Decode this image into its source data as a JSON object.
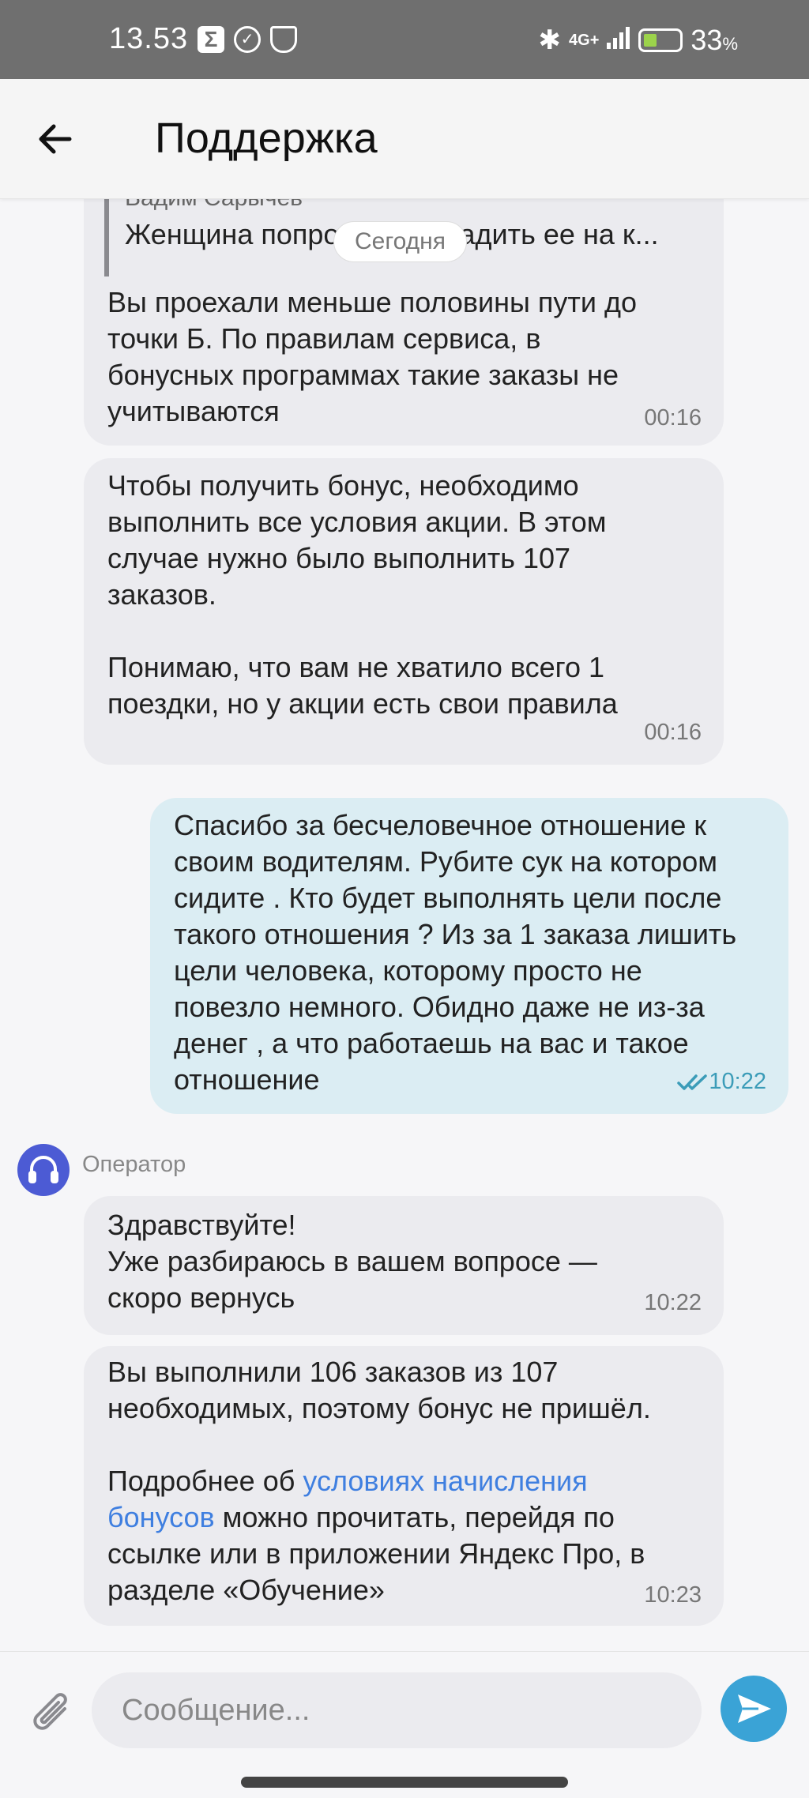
{
  "status_bar": {
    "time": "13.53",
    "network": "4G+",
    "battery": "33",
    "battery_unit": "%"
  },
  "header": {
    "title": "Поддержка"
  },
  "date_chip": "Сегодня",
  "messages": [
    {
      "quote_name": "Вадим Сарычев",
      "quote_text": "Женщина попросила высадить ее на к...",
      "text": "Вы проехали меньше половины пути до\nточки Б. По правилам сервиса, в\nбонусных программах такие заказы не\nучитываются",
      "time": "00:16"
    },
    {
      "text": "Чтобы получить бонус, необходимо\nвыполнить все условия акции. В этом\nслучае нужно было выполнить 107\nзаказов.\n\nПонимаю, что вам не хватило всего 1\nпоездки, но у акции есть свои правила",
      "time": "00:16"
    },
    {
      "text": "Спасибо за бесчеловечное отношение к\nсвоим водителям. Рубите сук на котором\nсидите . Кто  будет выполнять цели после\nтакого отношения ? Из за 1 заказа лишить\nцели человека, которому просто не\nповезло немного.  Обидно даже не из-за\nденег , а что работаешь на вас и такое\nотношение",
      "time": "10:22"
    },
    {
      "text": "Здравствуйте!\nУже разбираюсь в вашем вопросе —\nскоро вернусь",
      "time": "10:22"
    },
    {
      "text": "Вы выполнили 106 заказов из 107\nнеобходимых, поэтому бонус не пришёл.\n\n",
      "text_before_link": "Подробнее об ",
      "link_text": "условиях начисления\nбонусов",
      "text_after_link": " можно прочитать, перейдя по\nссылке или в приложении Яндекс Про, в\nразделе «Обучение»",
      "time": "10:23"
    }
  ],
  "operator_label": "Оператор",
  "composer": {
    "placeholder": "Сообщение..."
  },
  "colors": {
    "incoming_bubble": "#ebebef",
    "outgoing_bubble": "#dbedf3",
    "link": "#3f7fe0",
    "send_button": "#3aa3d6",
    "operator_avatar": "#4c5bd4"
  }
}
